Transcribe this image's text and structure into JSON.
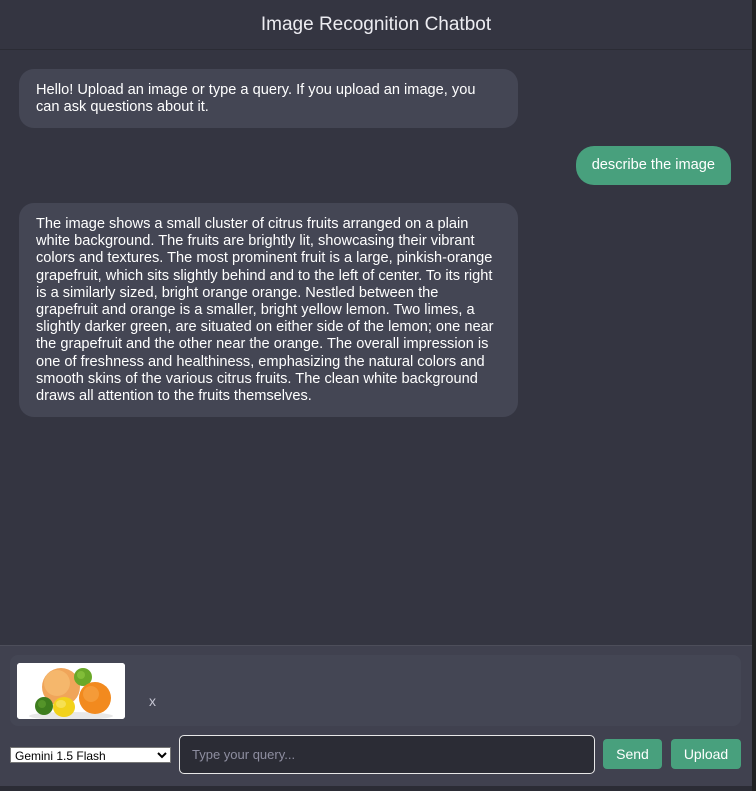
{
  "header": {
    "title": "Image Recognition Chatbot"
  },
  "messages": [
    {
      "role": "bot",
      "text": "Hello! Upload an image or type a query. If you upload an image, you can ask questions about it."
    },
    {
      "role": "user",
      "text": "describe the image"
    },
    {
      "role": "bot",
      "text": "The image shows a small cluster of citrus fruits arranged on a plain white background. The fruits are brightly lit, showcasing their vibrant colors and textures. The most prominent fruit is a large, pinkish-orange grapefruit, which sits slightly behind and to the left of center. To its right is a similarly sized, bright orange orange. Nestled between the grapefruit and orange is a smaller, bright yellow lemon. Two limes, a slightly darker green, are situated on either side of the lemon; one near the grapefruit and the other near the orange. The overall impression is one of freshness and healthiness, emphasizing the natural colors and smooth skins of the various citrus fruits. The clean white background draws all attention to the fruits themselves."
    }
  ],
  "preview": {
    "remove_label": "x"
  },
  "controls": {
    "model_selected": "Gemini 1.5 Flash",
    "query_placeholder": "Type your query...",
    "query_value": "",
    "send_label": "Send",
    "upload_label": "Upload"
  },
  "colors": {
    "background": "#343541",
    "bot_bubble": "#444654",
    "user_bubble": "#48a07d",
    "accent": "#48a07d"
  }
}
